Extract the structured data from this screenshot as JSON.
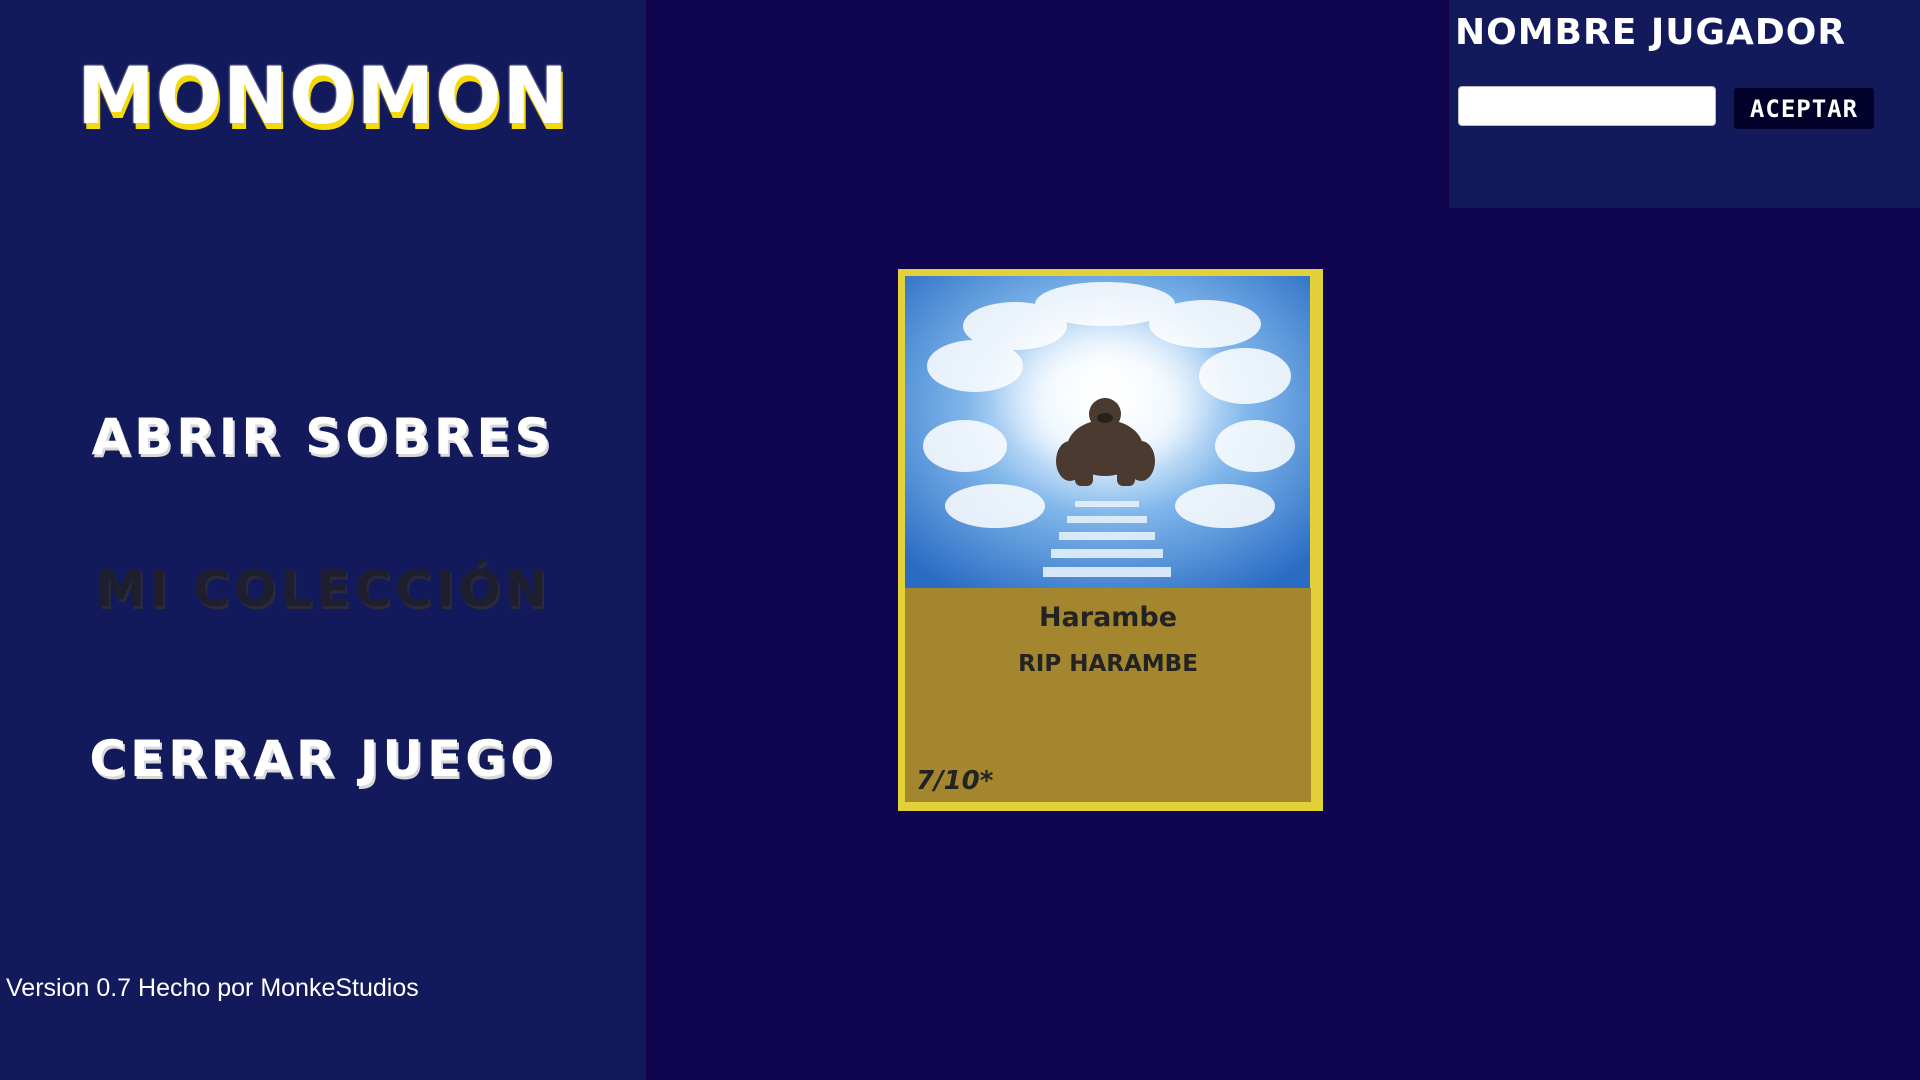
{
  "sidebar": {
    "logo": "MONOMON",
    "menu": {
      "open_packs": "ABRIR SOBRES",
      "my_collection": "MI COLECCIÓN",
      "close_game": "CERRAR JUEGO"
    },
    "version": "Version 0.7 Hecho por MonkeStudios"
  },
  "player": {
    "title": "NOMBRE JUGADOR",
    "input_value": "",
    "accept_label": "ACEPTAR"
  },
  "card": {
    "name": "Harambe",
    "description": "RIP HARAMBE",
    "rating": "7/10*",
    "image_icon": "gorilla-in-heaven-image"
  },
  "colors": {
    "background": "#10064f",
    "panel": "#131a5c",
    "logo_shadow": "#f5d90a",
    "card_border": "#e3d13a",
    "card_body": "#a4862f",
    "accept_button": "#020129"
  }
}
